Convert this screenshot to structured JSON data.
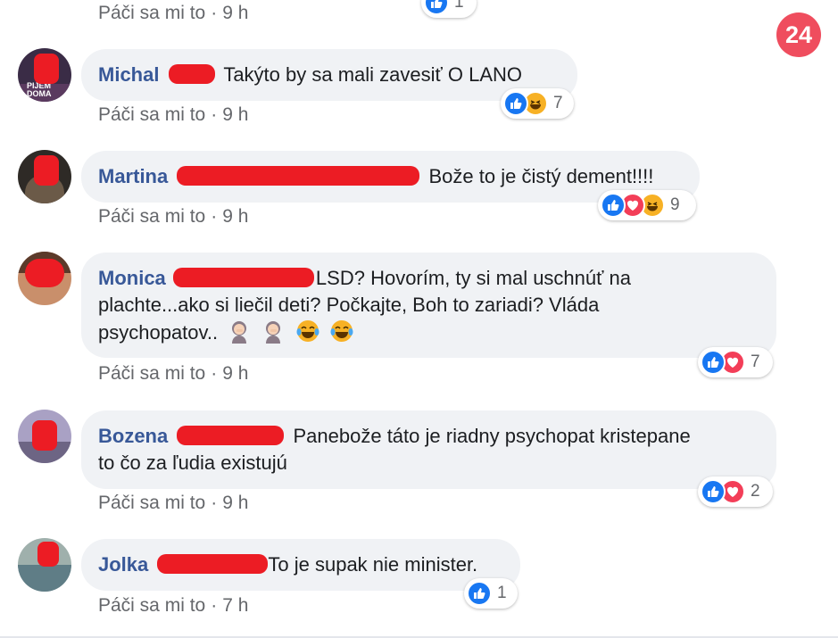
{
  "top": {
    "like_label": "Páči sa mi to",
    "time": "9 h",
    "reaction_count": "1"
  },
  "logo_text": "24",
  "comments": [
    {
      "author": "Michal",
      "text": "Takýto by sa mali zavesiť O LANO",
      "like_label": "Páči sa mi to",
      "time": "9 h",
      "reaction_count": "7",
      "reactions": [
        "like-icon",
        "haha-icon"
      ],
      "avatar_text": "PIJEM DOMA"
    },
    {
      "author": "Martina",
      "text": "Bože to je čistý dement!!!!",
      "like_label": "Páči sa mi to",
      "time": "9 h",
      "reaction_count": "9",
      "reactions": [
        "like-icon",
        "love-icon",
        "haha-icon"
      ]
    },
    {
      "author": "Monica",
      "text_line1": "LSD? Hovorím, ty si mal uschnúť na",
      "text_line2": "plachte...ako si liečil deti? Počkajte, Boh to zariadi? Vláda",
      "text_line3": "psychopatov..",
      "like_label": "Páči sa mi to",
      "time": "9 h",
      "reaction_count": "7",
      "reactions": [
        "like-icon",
        "love-icon"
      ]
    },
    {
      "author": "Bozena",
      "text_line1": "Panebože táto je riadny psychopat kristepane",
      "text_line2": "to čo za ľudia existujú",
      "like_label": "Páči sa mi to",
      "time": "9 h",
      "reaction_count": "2",
      "reactions": [
        "like-icon",
        "love-icon"
      ]
    },
    {
      "author": "Jolka",
      "text": "To je supak nie minister.",
      "like_label": "Páči sa mi to",
      "time": "7 h",
      "reaction_count": "1",
      "reactions": [
        "like-icon"
      ]
    }
  ],
  "colors": {
    "author": "#385898",
    "bubble": "#f0f2f5",
    "meta": "#65676b",
    "redaction": "#ec1c24",
    "like": "#1877f2",
    "love": "#f33e58",
    "haha": "#f7b125",
    "logo": "#ef4d5e"
  }
}
